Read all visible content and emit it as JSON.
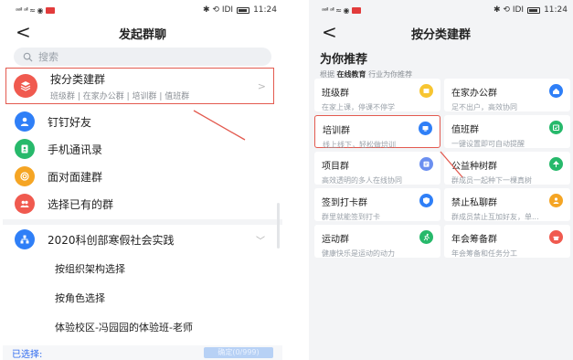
{
  "left": {
    "status": {
      "signal": "ᵃᵃˡˡ ᵃˡˡ ≈ ◉",
      "right": "✱ ⟲ ⅠDⅠ",
      "time": "11:24"
    },
    "nav": {
      "back": "<",
      "title": "发起群聊"
    },
    "search": {
      "placeholder": "搜索"
    },
    "category": {
      "title": "按分类建群",
      "sub": "班级群 | 在家办公群 | 培训群 | 值班群",
      "chevron": ">"
    },
    "menu": [
      {
        "label": "钉钉好友",
        "color": "#2f7ff7",
        "icon": "person-icon"
      },
      {
        "label": "手机通讯录",
        "color": "#27b96b",
        "icon": "phone-book-icon"
      },
      {
        "label": "面对面建群",
        "color": "#f5a524",
        "icon": "radar-icon"
      },
      {
        "label": "选择已有的群",
        "color": "#f05a4f",
        "icon": "group-icon"
      }
    ],
    "org": {
      "label": "2020科创部寒假社会实践",
      "color": "#2f7ff7",
      "icon": "org-icon",
      "chevron": "﹀"
    },
    "sub_items": [
      "按组织架构选择",
      "按角色选择",
      "体验校区-冯园园的体验班-老师"
    ],
    "bottom": {
      "selected": "已选择:",
      "confirm": "确定(0/999)"
    }
  },
  "right": {
    "status": {
      "signal": "ᵃᵃˡˡ ᵃˡˡ ≈ ◉",
      "right": "✱ ⟲ ⅠDⅠ",
      "time": "11:24"
    },
    "nav": {
      "back": "<",
      "title": "按分类建群"
    },
    "rec_title": "为你推荐",
    "rec_sub_prefix": "根据",
    "rec_sub_bold": "在线教育",
    "rec_sub_suffix": "行业为你推荐",
    "cards": [
      {
        "title": "班级群",
        "desc": "在家上课，停课不停学",
        "color": "#f7c531",
        "icon": "class-icon"
      },
      {
        "title": "在家办公群",
        "desc": "足不出户，高效协同",
        "color": "#2f7ff7",
        "icon": "home-icon"
      },
      {
        "title": "培训群",
        "desc": "线上线下，轻松做培训",
        "color": "#2f7ff7",
        "icon": "training-icon"
      },
      {
        "title": "值班群",
        "desc": "一键设置即可自动提醒",
        "color": "#27b96b",
        "icon": "duty-icon"
      },
      {
        "title": "项目群",
        "desc": "高效透明的多人在线协同",
        "color": "#6b8ff0",
        "icon": "project-icon"
      },
      {
        "title": "公益种树群",
        "desc": "群成员一起种下一棵真树",
        "color": "#27b96b",
        "icon": "tree-icon"
      },
      {
        "title": "签到打卡群",
        "desc": "群里就能签到打卡",
        "color": "#2f7ff7",
        "icon": "checkin-icon"
      },
      {
        "title": "禁止私聊群",
        "desc": "群成员禁止互加好友，单...",
        "color": "#f5a524",
        "icon": "no-chat-icon"
      },
      {
        "title": "运动群",
        "desc": "健康快乐是运动的动力",
        "color": "#27b96b",
        "icon": "sport-icon"
      },
      {
        "title": "年会筹备群",
        "desc": "年会筹备和任务分工",
        "color": "#f05a4f",
        "icon": "party-icon"
      }
    ]
  },
  "colors": {
    "highlight": "#e35a4f",
    "brand": "#2f7ff7",
    "category_icon": "#f05a4f"
  }
}
